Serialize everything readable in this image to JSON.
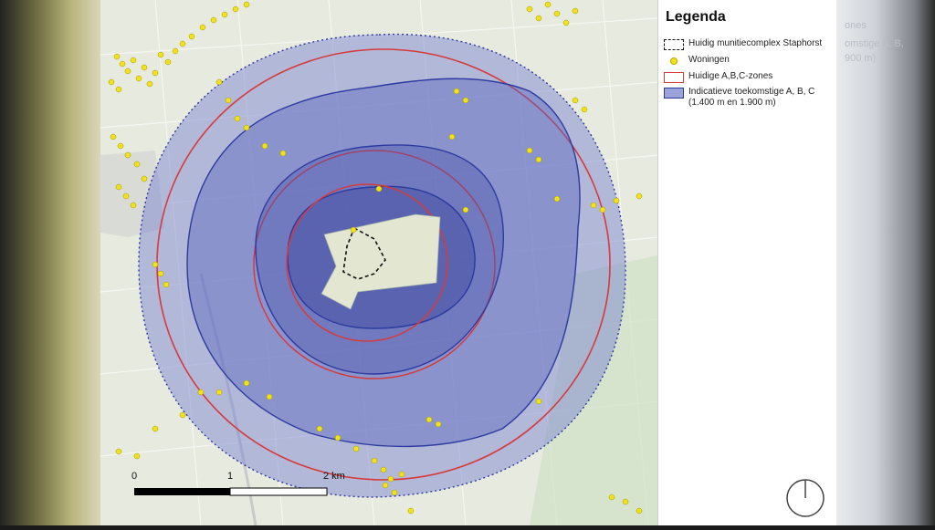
{
  "legend": {
    "title": "Legenda",
    "items": [
      {
        "symbol": "dashed-outline",
        "label": "Huidig munitiecomplex Staphorst",
        "color": "#111111"
      },
      {
        "symbol": "yellow-dot",
        "label": "Woningen",
        "color": "#f3e21a"
      },
      {
        "symbol": "red-outline",
        "label": "Huidige A,B,C-zones",
        "color": "#d73a3a"
      },
      {
        "symbol": "blue-fill",
        "label": "Indicatieve toekomstige A, B, C (1.400 m en 1.900 m)",
        "color": "#2d3aa0"
      }
    ]
  },
  "scalebar": {
    "labels": [
      "0",
      "1",
      "2 km"
    ]
  },
  "colors": {
    "map_background": "#e8eadf",
    "zone_fill": "#7b86d2",
    "zone_stroke": "#2d3aa0",
    "current_zone": "#d73a3a",
    "houses": "#f3e21a"
  },
  "icons": {
    "north_arrow": "north-arrow-icon"
  },
  "background_ghost_text": [
    "ones",
    "omstige A, B,",
    "900 m)"
  ]
}
